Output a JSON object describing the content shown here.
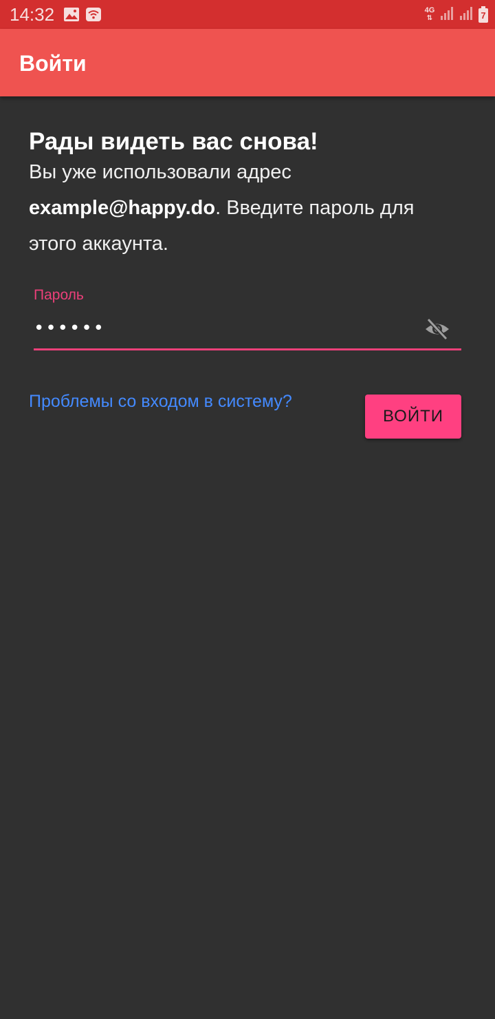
{
  "status_bar": {
    "time": "14:32",
    "network_type": "4G",
    "battery_level": "7",
    "icons": [
      "image-icon",
      "wifi-icon",
      "signal-icon",
      "signal-icon",
      "battery-icon"
    ]
  },
  "app_bar": {
    "title": "Войти",
    "color": "#ef5350"
  },
  "welcome": {
    "title": "Рады видеть вас снова!",
    "message_prefix": "Вы уже использовали адрес",
    "email": "example@happy.do",
    "message_suffix": ". Введите пароль для этого аккаунта."
  },
  "password_field": {
    "label": "Пароль",
    "value": "••••••",
    "visibility_icon": "visibility-off-icon",
    "accent_color": "#ec407a"
  },
  "actions": {
    "trouble_link": "Проблемы со входом в систему?",
    "signin_label": "ВОЙТИ",
    "button_color": "#ff4081",
    "link_color": "#448aff"
  },
  "colors": {
    "status_bar": "#d32f2f",
    "background": "#303030"
  }
}
